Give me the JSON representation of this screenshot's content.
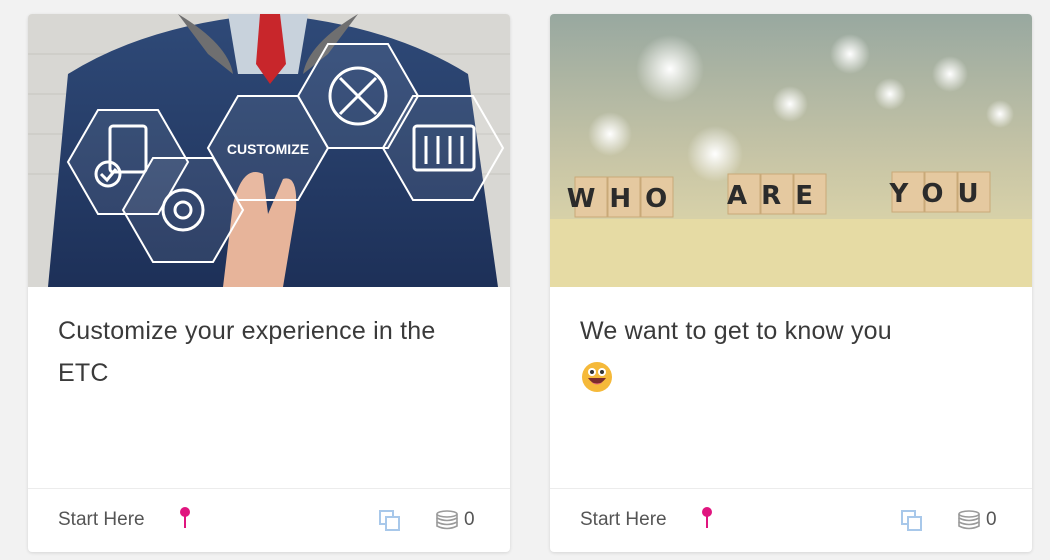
{
  "cards": [
    {
      "title": "Customize your experience in the ETC",
      "image_text": "CUSTOMIZE",
      "footer_label": "Start Here",
      "count": "0"
    },
    {
      "title": "We want to get to know you",
      "image_tiles": [
        "WHO",
        "ARE",
        "YOU"
      ],
      "footer_label": "Start Here",
      "count": "0"
    }
  ],
  "icons": {
    "pin": "pin-icon",
    "copy": "copy-icon",
    "coins": "coins-icon",
    "emoji": "grinning-face-emoji"
  },
  "colors": {
    "pin": "#e0157f",
    "copy": "#a8c8ea",
    "coins": "#9a9a9a",
    "emoji": "#f5b93a"
  }
}
